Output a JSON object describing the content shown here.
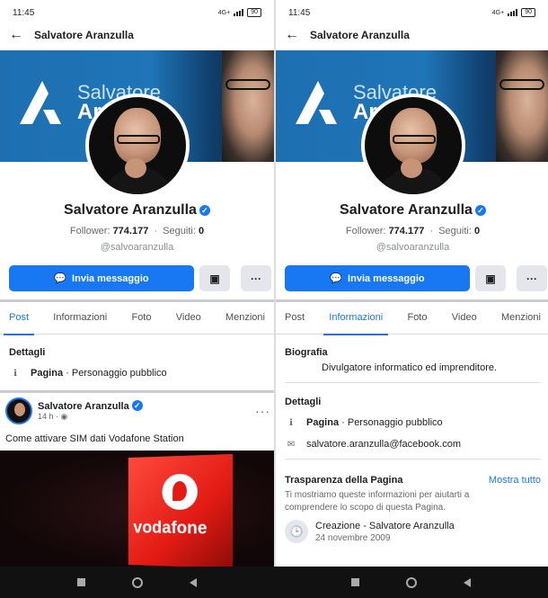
{
  "status": {
    "time": "11:45",
    "battery": "90",
    "net": "4G+"
  },
  "topbar": {
    "back_icon": "back-arrow-icon",
    "title": "Salvatore Aranzulla"
  },
  "cover": {
    "line1": "Salvatore",
    "line2": "Ar"
  },
  "profile": {
    "name": "Salvatore Aranzulla",
    "followers_label": "Follower:",
    "followers_value": "774.177",
    "following_label": "Seguiti:",
    "following_value": "0",
    "handle": "@salvoaranzulla",
    "message_button": "Invia messaggio",
    "more_button": "···"
  },
  "tabs": [
    "Post",
    "Informazioni",
    "Foto",
    "Video",
    "Menzioni"
  ],
  "left": {
    "active_tab": 0,
    "details_title": "Dettagli",
    "details_row_bold": "Pagina",
    "details_row_text": " · Personaggio pubblico",
    "post": {
      "author": "Salvatore Aranzulla",
      "time": "14 h",
      "text": "Come attivare SIM dati Vodafone Station",
      "image_brand": "vodafone"
    }
  },
  "right": {
    "active_tab": 1,
    "bio_title": "Biografia",
    "bio_text": "Divulgatore informatico ed imprenditore.",
    "details_title": "Dettagli",
    "details_row_bold": "Pagina",
    "details_row_text": " · Personaggio pubblico",
    "email": "salvatore.aranzulla@facebook.com",
    "transparency_title": "Trasparenza della Pagina",
    "transparency_link": "Mostra tutto",
    "transparency_text": "Ti mostriamo queste informazioni per aiutarti a comprendere lo scopo di questa Pagina.",
    "creation_label": "Creazione - Salvatore Aranzulla",
    "creation_date": "24 novembre 2009"
  },
  "colors": {
    "accent": "#1877f2"
  }
}
